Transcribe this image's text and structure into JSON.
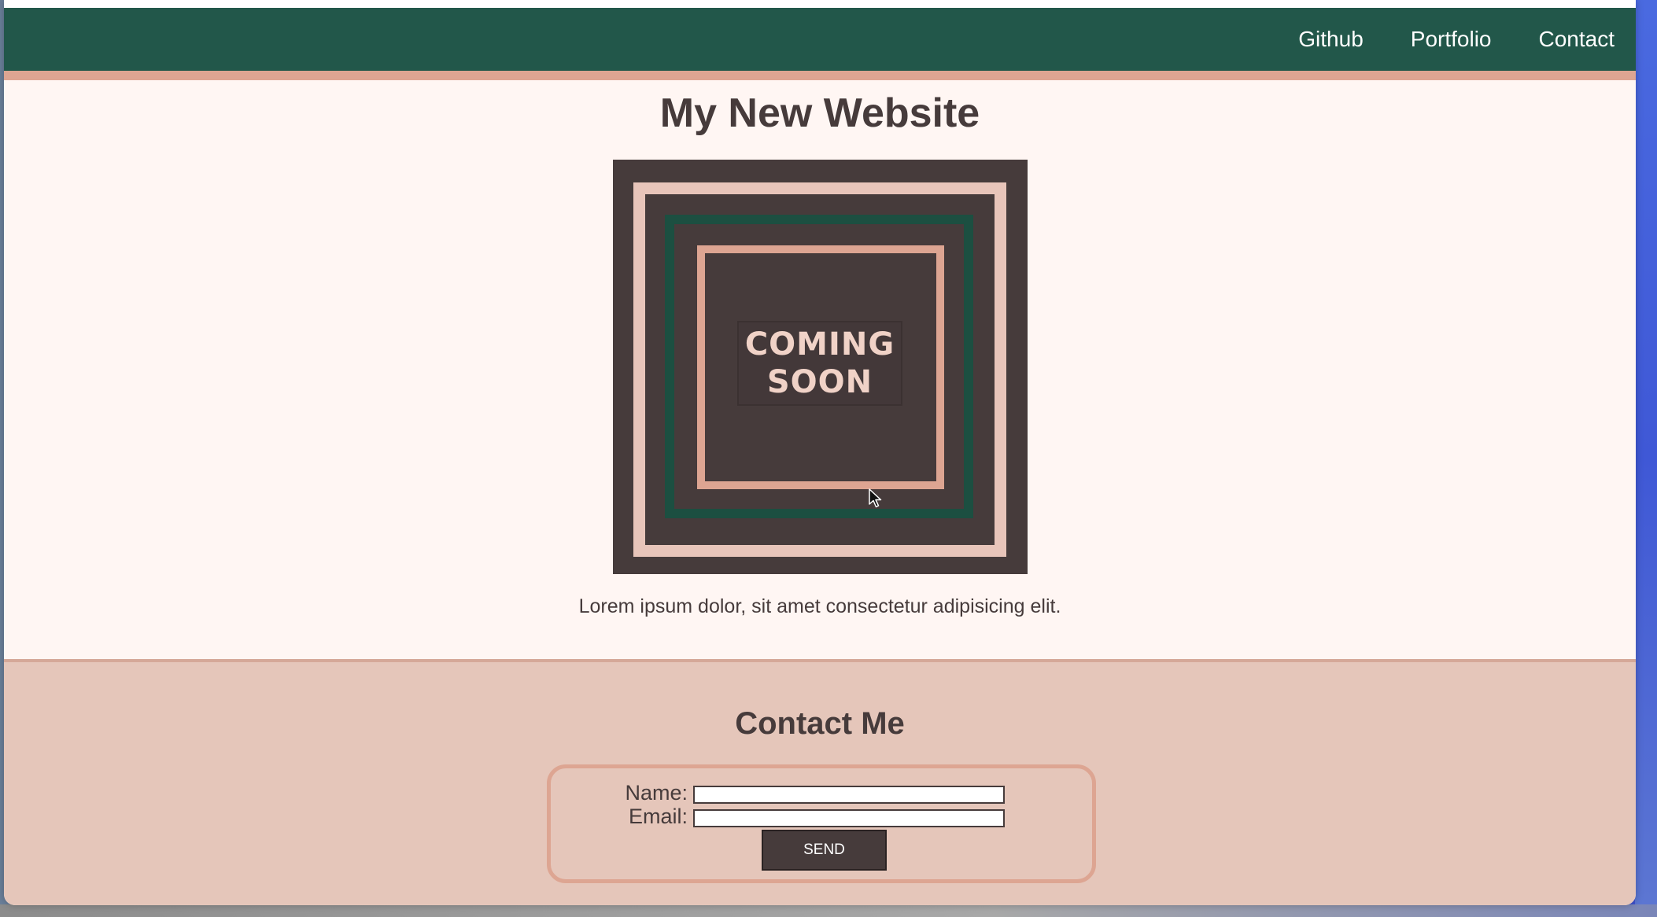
{
  "nav": {
    "links": [
      "Github",
      "Portfolio",
      "Contact"
    ]
  },
  "main": {
    "title": "My New Website",
    "hero_text_line1": "COMING",
    "hero_text_line2": "SOON",
    "body_text": "Lorem ipsum dolor, sit amet consectetur adipisicing elit."
  },
  "contact": {
    "title": "Contact Me",
    "name_label": "Name:",
    "email_label": "Email:",
    "name_value": "",
    "email_value": "",
    "send_label": "SEND"
  },
  "colors": {
    "nav_bg": "#22574a",
    "accent": "#dda592",
    "page_bg": "#fff6f3",
    "footer_bg": "#e5c6ba",
    "dark": "#463b3b"
  },
  "icons": [
    "mouse-cursor-icon"
  ]
}
